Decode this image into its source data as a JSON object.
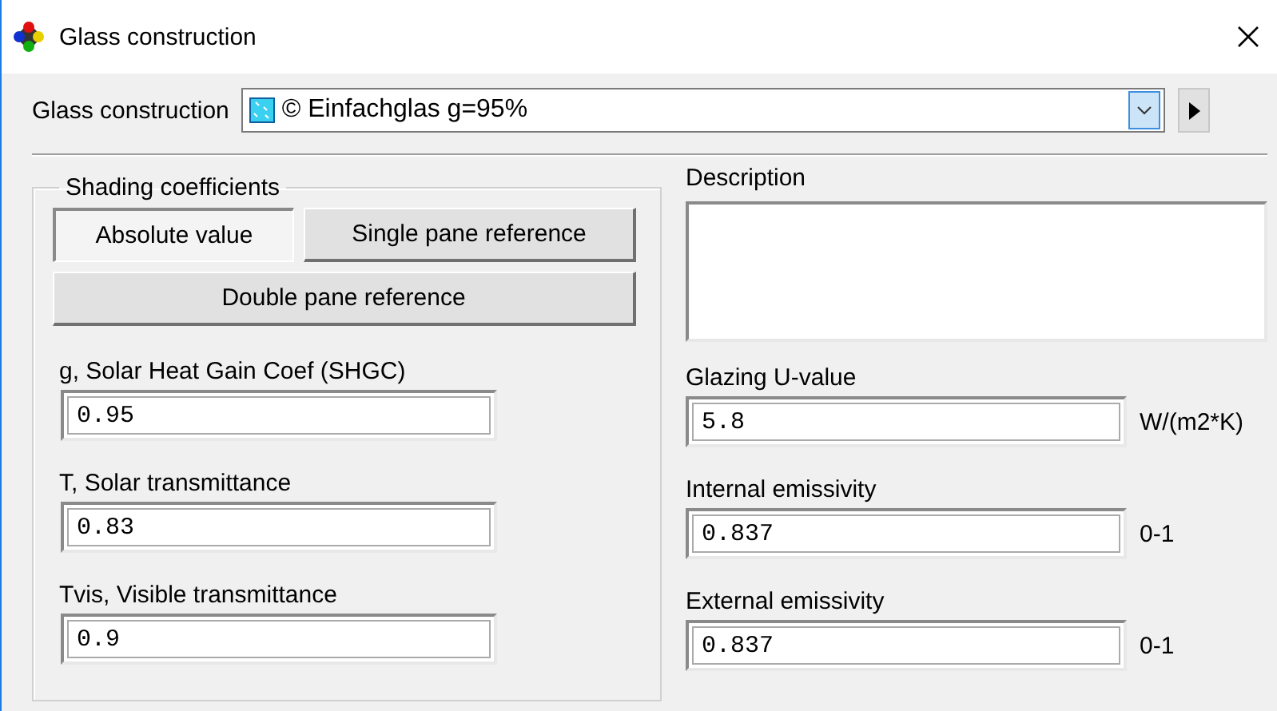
{
  "window": {
    "title": "Glass construction"
  },
  "construction": {
    "label": "Glass construction",
    "value": "© Einfachglas g=95%"
  },
  "shading": {
    "title": "Shading coefficients",
    "modes": [
      {
        "label": "Absolute value",
        "selected": true
      },
      {
        "label": "Single pane reference",
        "selected": false
      },
      {
        "label": "Double pane reference",
        "selected": false
      }
    ],
    "fields": [
      {
        "label": "g, Solar Heat Gain Coef (SHGC)",
        "value": "0.95"
      },
      {
        "label": "T, Solar transmittance",
        "value": "0.83"
      },
      {
        "label": "Tvis, Visible transmittance",
        "value": "0.9"
      }
    ]
  },
  "description": {
    "label": "Description"
  },
  "properties": [
    {
      "label": "Glazing U-value",
      "value": "5.8",
      "unit": "W/(m2*K)"
    },
    {
      "label": "Internal emissivity",
      "value": "0.837",
      "unit": "0-1"
    },
    {
      "label": "External emissivity",
      "value": "0.837",
      "unit": "0-1"
    }
  ]
}
